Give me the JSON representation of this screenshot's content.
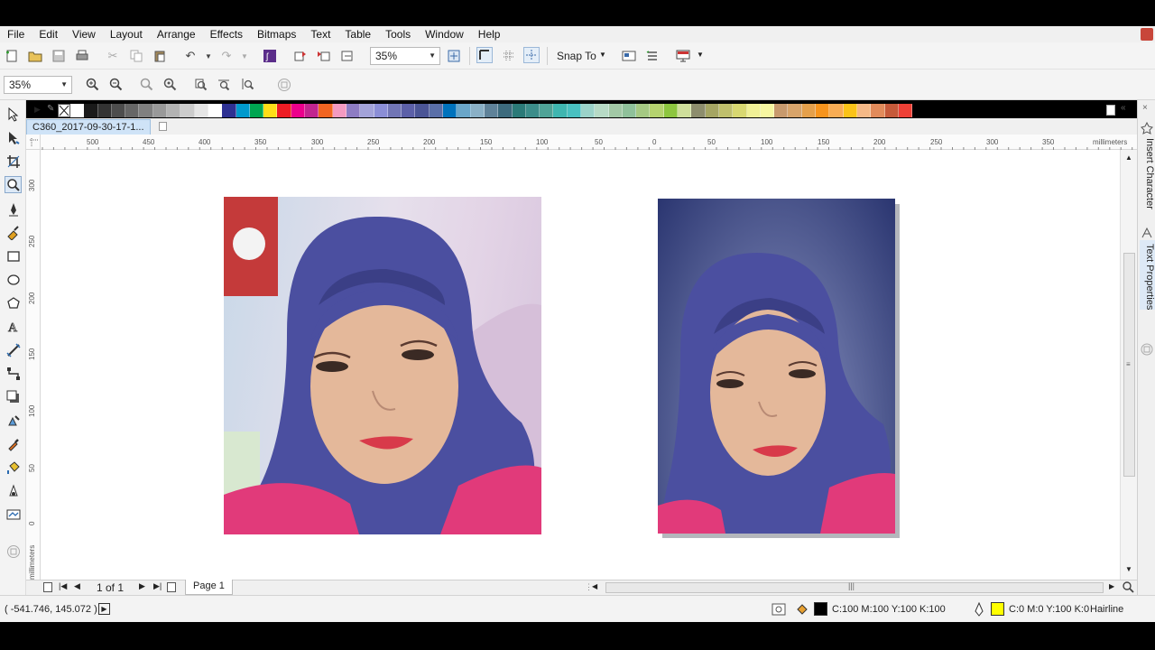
{
  "menu": {
    "items": [
      "File",
      "Edit",
      "View",
      "Layout",
      "Arrange",
      "Effects",
      "Bitmaps",
      "Text",
      "Table",
      "Tools",
      "Window",
      "Help"
    ]
  },
  "toolbar": {
    "zoom_value": "35%",
    "snap_to_label": "Snap To"
  },
  "property_bar": {
    "zoom_value": "35%"
  },
  "document": {
    "tab_title": "C360_2017-09-30-17-1..."
  },
  "ruler": {
    "unit_label": "millimeters",
    "h_ticks": [
      "500",
      "450",
      "400",
      "350",
      "300",
      "250",
      "200",
      "150",
      "100",
      "50",
      "0",
      "50",
      "100",
      "150",
      "200",
      "250",
      "300",
      "350"
    ],
    "v_ticks": [
      "300",
      "250",
      "200",
      "150",
      "100",
      "50",
      "0"
    ],
    "v_unit_label": "millimeters"
  },
  "palette": {
    "colors": [
      "#ffffff",
      "#1a1a1a",
      "#333333",
      "#4d4d4d",
      "#666666",
      "#808080",
      "#999999",
      "#b3b3b3",
      "#cccccc",
      "#e6e6e6",
      "#ffffff",
      "#2e3192",
      "#0099cc",
      "#00a651",
      "#ffde17",
      "#ed1c24",
      "#ec008c",
      "#c2258f",
      "#f26522",
      "#f49ac1",
      "#8e7cc3",
      "#a3a3d9",
      "#8b8ed6",
      "#7175b5",
      "#5c60a8",
      "#4b5596",
      "#5a6fa8",
      "#0072bc",
      "#6aa6c9",
      "#8ab0c6",
      "#5f8299",
      "#3d6b7d",
      "#2b7a78",
      "#3c8d8a",
      "#4fa397",
      "#3fb6b0",
      "#49c0c0",
      "#9bd3c9",
      "#b7dbc6",
      "#a2c9a6",
      "#8fc19a",
      "#a5c983",
      "#b5d36f",
      "#8dc63f",
      "#cfdf9b",
      "#8d8d6d",
      "#a5a563",
      "#bfbf6c",
      "#d8d871",
      "#f0f096",
      "#f7f7a1",
      "#c89a6d",
      "#d8a46a",
      "#e5a04b",
      "#f7941d",
      "#f9ad54",
      "#fbc318",
      "#f5b987",
      "#e28b5b",
      "#c65a3a",
      "#ee4036"
    ]
  },
  "page_nav": {
    "page_count": "1 of 1",
    "page_tab": "Page 1"
  },
  "status": {
    "coordinates": "( -541.746, 145.072 )",
    "fill_color_text": "C:100 M:100 Y:100 K:100",
    "fill_swatch": "#000000",
    "outline_color_text": "C:0 M:0 Y:100 K:0",
    "outline_swatch": "#ffff00",
    "outline_width": "Hairline"
  },
  "dockers": {
    "insert_character": "Insert Character",
    "text_properties": "Text Properties"
  }
}
